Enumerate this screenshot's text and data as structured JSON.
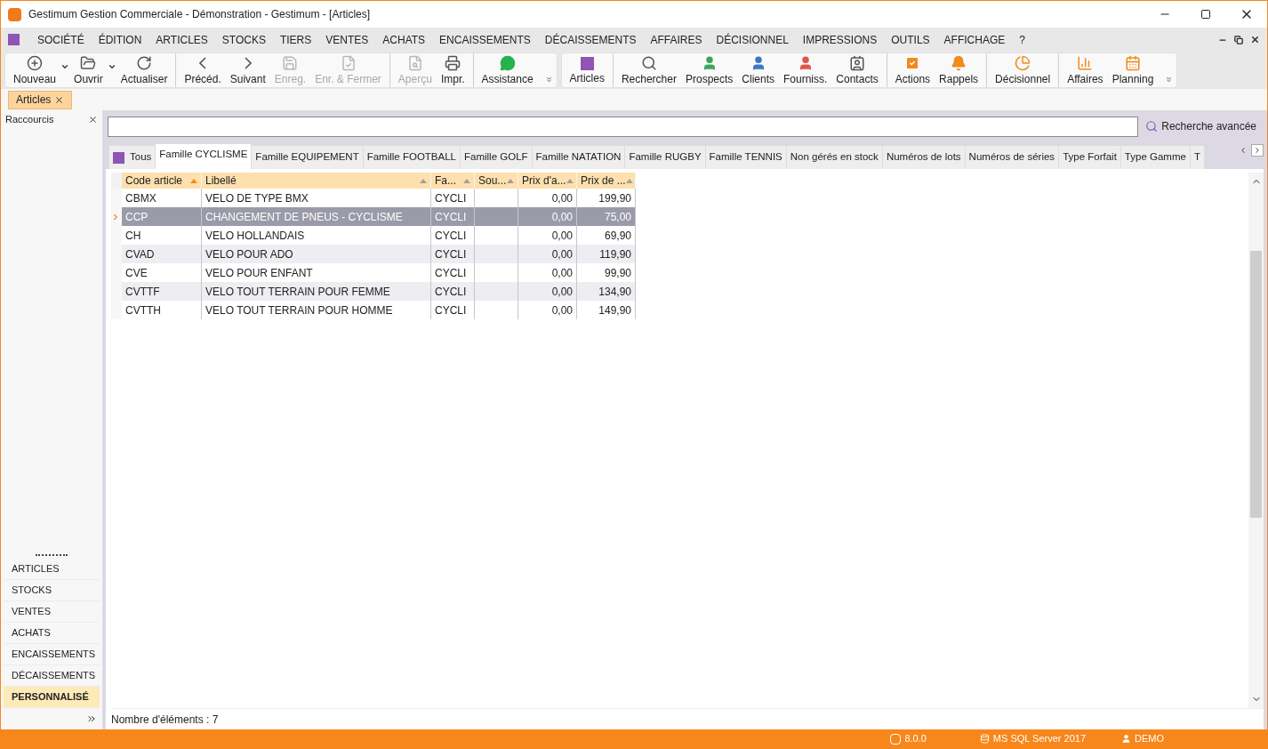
{
  "window": {
    "title": "Gestimum Gestion Commerciale - Démonstration - Gestimum - [Articles]"
  },
  "menu": [
    "SOCIÉTÉ",
    "ÉDITION",
    "ARTICLES",
    "STOCKS",
    "TIERS",
    "VENTES",
    "ACHATS",
    "ENCAISSEMENTS",
    "DÉCAISSEMENTS",
    "AFFAIRES",
    "DÉCISIONNEL",
    "IMPRESSIONS",
    "OUTILS",
    "AFFICHAGE",
    "?"
  ],
  "toolbar": [
    [
      {
        "kind": "new",
        "label": "Nouveau",
        "disabled": false,
        "dropdown": true
      },
      {
        "kind": "open",
        "label": "Ouvrir",
        "disabled": false,
        "dropdown": true
      },
      {
        "kind": "refresh",
        "label": "Actualiser",
        "disabled": false,
        "dropdown": false
      }
    ],
    [
      {
        "kind": "prev",
        "label": "Précéd.",
        "disabled": false,
        "dropdown": false
      },
      {
        "kind": "next",
        "label": "Suivant",
        "disabled": false,
        "dropdown": false
      },
      {
        "kind": "save",
        "label": "Enreg.",
        "disabled": true,
        "dropdown": false
      },
      {
        "kind": "saveclose",
        "label": "Enr. & Fermer",
        "disabled": true,
        "dropdown": false
      }
    ],
    [
      {
        "kind": "preview",
        "label": "Aperçu",
        "disabled": true,
        "dropdown": false
      },
      {
        "kind": "print",
        "label": "Impr.",
        "disabled": false,
        "dropdown": false
      }
    ],
    [
      {
        "kind": "chat",
        "label": "Assistance",
        "disabled": false,
        "dropdown": false
      }
    ]
  ],
  "toolbar2": [
    [
      {
        "kind": "square",
        "label": "Articles",
        "disabled": false,
        "dropdown": false
      }
    ],
    [
      {
        "kind": "search",
        "label": "Rechercher",
        "disabled": false,
        "dropdown": false
      },
      {
        "kind": "person",
        "label": "Prospects",
        "disabled": false,
        "dropdown": false,
        "color": "#3fa45b"
      },
      {
        "kind": "person",
        "label": "Clients",
        "disabled": false,
        "dropdown": false,
        "color": "#3b78c4"
      },
      {
        "kind": "person",
        "label": "Fourniss.",
        "disabled": false,
        "dropdown": false,
        "color": "#e0554b"
      },
      {
        "kind": "contacts",
        "label": "Contacts",
        "disabled": false,
        "dropdown": false
      }
    ],
    [
      {
        "kind": "check",
        "label": "Actions",
        "disabled": false,
        "dropdown": false
      },
      {
        "kind": "bell",
        "label": "Rappels",
        "disabled": false,
        "dropdown": false
      }
    ],
    [
      {
        "kind": "pie",
        "label": "Décisionnel",
        "disabled": false,
        "dropdown": false
      }
    ],
    [
      {
        "kind": "chart",
        "label": "Affaires",
        "disabled": false,
        "dropdown": false
      },
      {
        "kind": "calendar",
        "label": "Planning",
        "disabled": false,
        "dropdown": false
      }
    ]
  ],
  "doc_tabs": [
    {
      "label": "Articles",
      "selected": true
    }
  ],
  "sidebar": {
    "title": "Raccourcis",
    "items": [
      {
        "label": "ARTICLES",
        "selected": false
      },
      {
        "label": "STOCKS",
        "selected": false
      },
      {
        "label": "VENTES",
        "selected": false
      },
      {
        "label": "ACHATS",
        "selected": false
      },
      {
        "label": "ENCAISSEMENTS",
        "selected": false
      },
      {
        "label": "DÉCAISSEMENTS",
        "selected": false
      },
      {
        "label": "PERSONNALISÉ",
        "selected": true
      }
    ]
  },
  "search": {
    "button": "Recherche avancée"
  },
  "filter_tabs": [
    {
      "label": "Tous",
      "selected": false,
      "icon": true
    },
    {
      "label": "Famille CYCLISME",
      "selected": true
    },
    {
      "label": "Famille EQUIPEMENT",
      "selected": false
    },
    {
      "label": "Famille FOOTBALL",
      "selected": false
    },
    {
      "label": "Famille GOLF",
      "selected": false
    },
    {
      "label": "Famille NATATION",
      "selected": false
    },
    {
      "label": "Famille RUGBY",
      "selected": false
    },
    {
      "label": "Famille TENNIS",
      "selected": false
    },
    {
      "label": "Non gérés en stock",
      "selected": false
    },
    {
      "label": "Numéros de lots",
      "selected": false
    },
    {
      "label": "Numéros de séries",
      "selected": false
    },
    {
      "label": "Type Forfait",
      "selected": false
    },
    {
      "label": "Type Gamme",
      "selected": false
    },
    {
      "label": "T",
      "selected": false
    }
  ],
  "table": {
    "columns": [
      {
        "label": "Code article",
        "sorted": true
      },
      {
        "label": "Libellé",
        "sorted": false
      },
      {
        "label": "Fa...",
        "sorted": false
      },
      {
        "label": "Sou...",
        "sorted": false
      },
      {
        "label": "Prix d'a...",
        "sorted": false
      },
      {
        "label": "Prix de ...",
        "sorted": false
      }
    ],
    "rows": [
      {
        "selected": false,
        "cells": [
          "CBMX",
          "VELO DE TYPE BMX",
          "CYCLI",
          "",
          "0,00",
          "199,90"
        ]
      },
      {
        "selected": true,
        "cells": [
          "CCP",
          "CHANGEMENT DE PNEUS - CYCLISME",
          "CYCLI",
          "",
          "0,00",
          "75,00"
        ]
      },
      {
        "selected": false,
        "cells": [
          "CH",
          "VELO HOLLANDAIS",
          "CYCLI",
          "",
          "0,00",
          "69,90"
        ]
      },
      {
        "selected": false,
        "cells": [
          "CVAD",
          "VELO POUR ADO",
          "CYCLI",
          "",
          "0,00",
          "119,90"
        ]
      },
      {
        "selected": false,
        "cells": [
          "CVE",
          "VELO POUR ENFANT",
          "CYCLI",
          "",
          "0,00",
          "99,90"
        ]
      },
      {
        "selected": false,
        "cells": [
          "CVTTF",
          "VELO TOUT TERRAIN POUR FEMME",
          "CYCLI",
          "",
          "0,00",
          "134,90"
        ]
      },
      {
        "selected": false,
        "cells": [
          "CVTTH",
          "VELO TOUT TERRAIN POUR HOMME",
          "CYCLI",
          "",
          "0,00",
          "149,90"
        ]
      }
    ]
  },
  "count": "Nombre d'éléments : 7",
  "status_bar": {
    "version": "8.0.0",
    "server": "MS SQL Server 2017",
    "user": "DEMO"
  }
}
